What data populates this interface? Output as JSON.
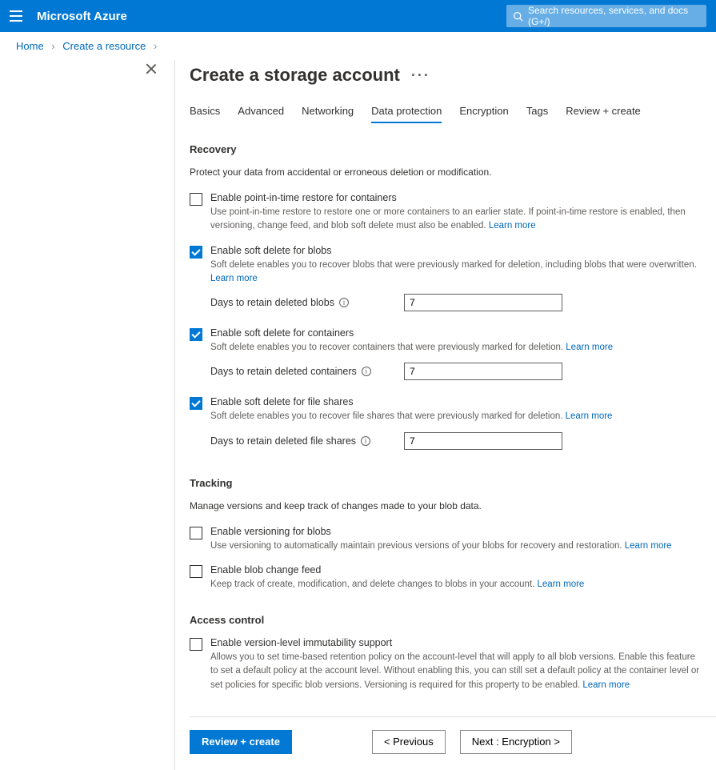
{
  "topbar": {
    "brand": "Microsoft Azure",
    "search_placeholder": "Search resources, services, and docs (G+/)"
  },
  "breadcrumb": {
    "items": [
      "Home",
      "Create a resource"
    ]
  },
  "blade": {
    "title": "Create a storage account"
  },
  "tabs": [
    {
      "label": "Basics",
      "active": false
    },
    {
      "label": "Advanced",
      "active": false
    },
    {
      "label": "Networking",
      "active": false
    },
    {
      "label": "Data protection",
      "active": true
    },
    {
      "label": "Encryption",
      "active": false
    },
    {
      "label": "Tags",
      "active": false
    },
    {
      "label": "Review + create",
      "active": false
    }
  ],
  "sections": {
    "recovery": {
      "heading": "Recovery",
      "intro": "Protect your data from accidental or erroneous deletion or modification.",
      "options": [
        {
          "title": "Enable point-in-time restore for containers",
          "desc": "Use point-in-time restore to restore one or more containers to an earlier state. If point-in-time restore is enabled, then versioning, change feed, and blob soft delete must also be enabled.",
          "learn": "Learn more",
          "checked": false
        },
        {
          "title": "Enable soft delete for blobs",
          "desc": "Soft delete enables you to recover blobs that were previously marked for deletion, including blobs that were overwritten.",
          "learn": "Learn more",
          "checked": true,
          "field_label": "Days to retain deleted blobs",
          "field_value": "7"
        },
        {
          "title": "Enable soft delete for containers",
          "desc": "Soft delete enables you to recover containers that were previously marked for deletion.",
          "learn": "Learn more",
          "checked": true,
          "field_label": "Days to retain deleted containers",
          "field_value": "7"
        },
        {
          "title": "Enable soft delete for file shares",
          "desc": "Soft delete enables you to recover file shares that were previously marked for deletion.",
          "learn": "Learn more",
          "checked": true,
          "field_label": "Days to retain deleted file shares",
          "field_value": "7"
        }
      ]
    },
    "tracking": {
      "heading": "Tracking",
      "intro": "Manage versions and keep track of changes made to your blob data.",
      "options": [
        {
          "title": "Enable versioning for blobs",
          "desc": "Use versioning to automatically maintain previous versions of your blobs for recovery and restoration.",
          "learn": "Learn more",
          "checked": false
        },
        {
          "title": "Enable blob change feed",
          "desc": "Keep track of create, modification, and delete changes to blobs in your account.",
          "learn": "Learn more",
          "checked": false
        }
      ]
    },
    "access": {
      "heading": "Access control",
      "options": [
        {
          "title": "Enable version-level immutability support",
          "desc": "Allows you to set time-based retention policy on the account-level that will apply to all blob versions. Enable this feature to set a default policy at the account level. Without enabling this, you can still set a default policy at the container level or set policies for specific blob versions. Versioning is required for this property to be enabled.",
          "learn": "Learn more",
          "checked": false
        }
      ]
    }
  },
  "footer": {
    "review": "Review + create",
    "previous": "<  Previous",
    "next": "Next : Encryption >"
  }
}
